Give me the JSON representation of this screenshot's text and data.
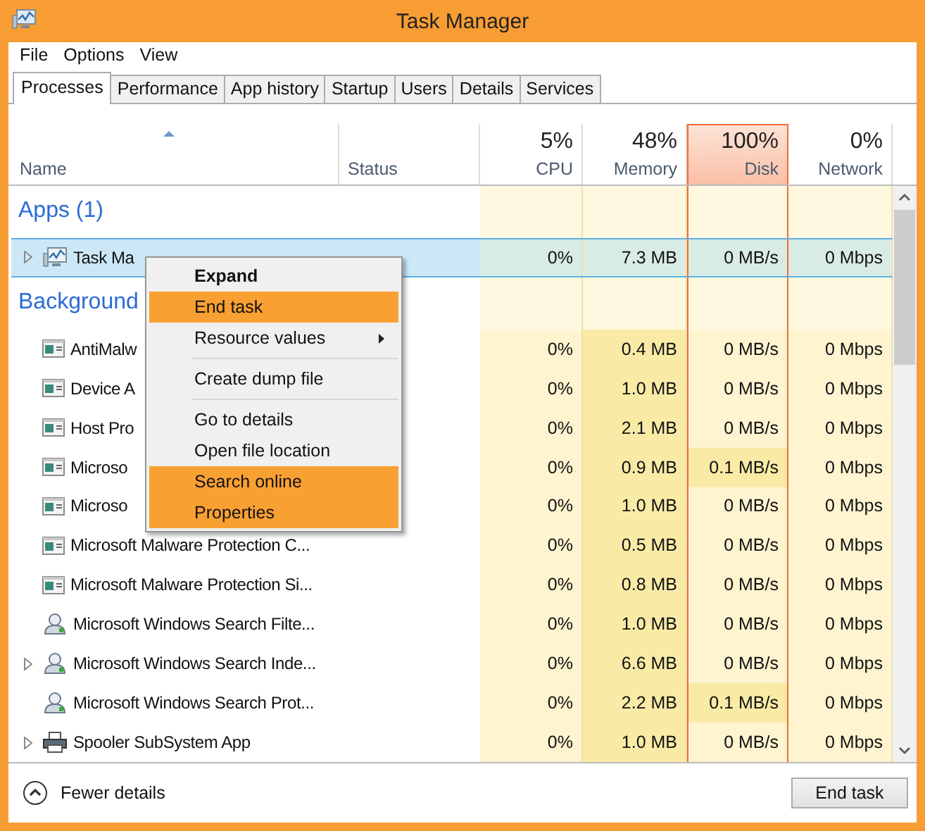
{
  "window": {
    "title": "Task Manager"
  },
  "menu": [
    "File",
    "Options",
    "View"
  ],
  "tabs": [
    {
      "label": "Processes",
      "selected": true
    },
    {
      "label": "Performance",
      "selected": false
    },
    {
      "label": "App history",
      "selected": false
    },
    {
      "label": "Startup",
      "selected": false
    },
    {
      "label": "Users",
      "selected": false
    },
    {
      "label": "Details",
      "selected": false
    },
    {
      "label": "Services",
      "selected": false
    }
  ],
  "name_column": {
    "label": "Name",
    "sorted": true
  },
  "status_column": {
    "label": "Status"
  },
  "metric_columns": [
    {
      "percent": "5%",
      "label": "CPU",
      "selected": false
    },
    {
      "percent": "48%",
      "label": "Memory",
      "selected": false
    },
    {
      "percent": "100%",
      "label": "Disk",
      "selected": true
    },
    {
      "percent": "0%",
      "label": "Network",
      "selected": false
    }
  ],
  "groups": [
    {
      "title": "Apps (1)",
      "rows": [
        {
          "name": "Task Ma",
          "kind": "monitor",
          "expandable": true,
          "selected": true,
          "cells": [
            {
              "text": "0%",
              "hot": false
            },
            {
              "text": "7.3 MB",
              "hot": false
            },
            {
              "text": "0 MB/s",
              "hot": false
            },
            {
              "text": "0 Mbps",
              "hot": false
            }
          ]
        }
      ]
    },
    {
      "title": "Background",
      "rows": [
        {
          "name": "AntiMalw",
          "kind": "window",
          "expandable": false,
          "selected": false,
          "cells": [
            {
              "text": "0%",
              "hot": false
            },
            {
              "text": "0.4 MB",
              "hot": true
            },
            {
              "text": "0 MB/s",
              "hot": false
            },
            {
              "text": "0 Mbps",
              "hot": false
            }
          ]
        },
        {
          "name": "Device A",
          "kind": "window",
          "expandable": false,
          "selected": false,
          "cells": [
            {
              "text": "0%",
              "hot": false
            },
            {
              "text": "1.0 MB",
              "hot": true
            },
            {
              "text": "0 MB/s",
              "hot": false
            },
            {
              "text": "0 Mbps",
              "hot": false
            }
          ]
        },
        {
          "name": "Host Pro",
          "kind": "window",
          "expandable": false,
          "selected": false,
          "cells": [
            {
              "text": "0%",
              "hot": false
            },
            {
              "text": "2.1 MB",
              "hot": true
            },
            {
              "text": "0 MB/s",
              "hot": false
            },
            {
              "text": "0 Mbps",
              "hot": false
            }
          ]
        },
        {
          "name": "Microso",
          "kind": "window",
          "expandable": false,
          "selected": false,
          "cells": [
            {
              "text": "0%",
              "hot": false
            },
            {
              "text": "0.9 MB",
              "hot": true
            },
            {
              "text": "0.1 MB/s",
              "hot": true
            },
            {
              "text": "0 Mbps",
              "hot": false
            }
          ]
        },
        {
          "name": "Microso",
          "kind": "window",
          "expandable": false,
          "selected": false,
          "cells": [
            {
              "text": "0%",
              "hot": false
            },
            {
              "text": "1.0 MB",
              "hot": true
            },
            {
              "text": "0 MB/s",
              "hot": false
            },
            {
              "text": "0 Mbps",
              "hot": false
            }
          ]
        },
        {
          "name": "Microsoft Malware Protection C...",
          "kind": "window",
          "expandable": false,
          "selected": false,
          "cells": [
            {
              "text": "0%",
              "hot": false
            },
            {
              "text": "0.5 MB",
              "hot": true
            },
            {
              "text": "0 MB/s",
              "hot": false
            },
            {
              "text": "0 Mbps",
              "hot": false
            }
          ]
        },
        {
          "name": "Microsoft Malware Protection Si...",
          "kind": "window",
          "expandable": false,
          "selected": false,
          "cells": [
            {
              "text": "0%",
              "hot": false
            },
            {
              "text": "0.8 MB",
              "hot": true
            },
            {
              "text": "0 MB/s",
              "hot": false
            },
            {
              "text": "0 Mbps",
              "hot": false
            }
          ]
        },
        {
          "name": "Microsoft Windows Search Filte...",
          "kind": "search",
          "expandable": false,
          "selected": false,
          "cells": [
            {
              "text": "0%",
              "hot": false
            },
            {
              "text": "1.0 MB",
              "hot": true
            },
            {
              "text": "0 MB/s",
              "hot": false
            },
            {
              "text": "0 Mbps",
              "hot": false
            }
          ]
        },
        {
          "name": "Microsoft Windows Search Inde...",
          "kind": "search",
          "expandable": true,
          "selected": false,
          "cells": [
            {
              "text": "0%",
              "hot": false
            },
            {
              "text": "6.6 MB",
              "hot": true
            },
            {
              "text": "0 MB/s",
              "hot": false
            },
            {
              "text": "0 Mbps",
              "hot": false
            }
          ]
        },
        {
          "name": "Microsoft Windows Search Prot...",
          "kind": "search",
          "expandable": false,
          "selected": false,
          "cells": [
            {
              "text": "0%",
              "hot": false
            },
            {
              "text": "2.2 MB",
              "hot": true
            },
            {
              "text": "0.1 MB/s",
              "hot": true
            },
            {
              "text": "0 Mbps",
              "hot": false
            }
          ]
        },
        {
          "name": "Spooler SubSystem App",
          "kind": "printer",
          "expandable": true,
          "selected": false,
          "cells": [
            {
              "text": "0%",
              "hot": false
            },
            {
              "text": "1.0 MB",
              "hot": true
            },
            {
              "text": "0 MB/s",
              "hot": false
            },
            {
              "text": "0 Mbps",
              "hot": false
            }
          ]
        }
      ]
    }
  ],
  "context_menu": [
    {
      "label": "Expand",
      "default": true,
      "highlighted": false,
      "submenu": false,
      "separator_before": false
    },
    {
      "label": "End task",
      "default": false,
      "highlighted": true,
      "submenu": false,
      "separator_before": false
    },
    {
      "label": "Resource values",
      "default": false,
      "highlighted": false,
      "submenu": true,
      "separator_before": false
    },
    {
      "label": "Create dump file",
      "default": false,
      "highlighted": false,
      "submenu": false,
      "separator_before": true
    },
    {
      "label": "Go to details",
      "default": false,
      "highlighted": false,
      "submenu": false,
      "separator_before": true
    },
    {
      "label": "Open file location",
      "default": false,
      "highlighted": false,
      "submenu": false,
      "separator_before": false
    },
    {
      "label": "Search online",
      "default": false,
      "highlighted": true,
      "submenu": false,
      "separator_before": false
    },
    {
      "label": "Properties",
      "default": false,
      "highlighted": true,
      "submenu": false,
      "separator_before": false
    }
  ],
  "footer": {
    "details_toggle": "Fewer details",
    "end_task_button": "End task"
  }
}
